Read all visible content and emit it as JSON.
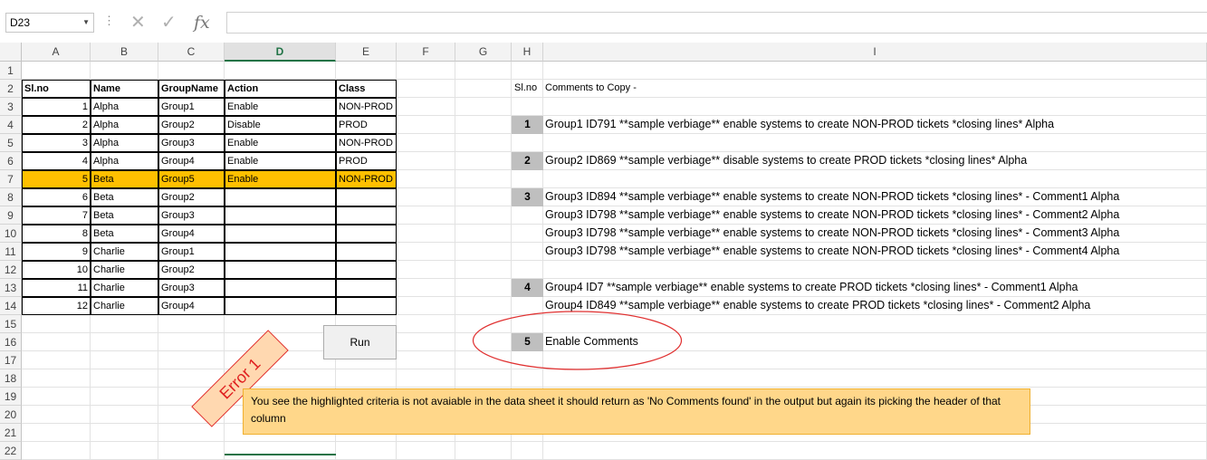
{
  "formula_bar": {
    "name_box": "D23",
    "dots": "⋮",
    "cancel_icon": "✕",
    "enter_icon": "✓",
    "fx_label": "fx",
    "formula": ""
  },
  "columns": [
    "A",
    "B",
    "C",
    "D",
    "E",
    "F",
    "G",
    "H",
    "I"
  ],
  "rows": [
    "1",
    "2",
    "3",
    "4",
    "5",
    "6",
    "7",
    "8",
    "9",
    "10",
    "11",
    "12",
    "13",
    "14",
    "15",
    "16",
    "17",
    "18",
    "19",
    "20",
    "21",
    "22"
  ],
  "table": {
    "headers": [
      "Sl.no",
      "Name",
      "GroupName",
      "Action",
      "Class"
    ],
    "rows": [
      [
        "1",
        "Alpha",
        "Group1",
        "Enable",
        "NON-PROD"
      ],
      [
        "2",
        "Alpha",
        "Group2",
        "Disable",
        "PROD"
      ],
      [
        "3",
        "Alpha",
        "Group3",
        "Enable",
        "NON-PROD"
      ],
      [
        "4",
        "Alpha",
        "Group4",
        "Enable",
        "PROD"
      ],
      [
        "5",
        "Beta",
        "Group5",
        "Enable",
        "NON-PROD"
      ],
      [
        "6",
        "Beta",
        "Group2",
        "",
        ""
      ],
      [
        "7",
        "Beta",
        "Group3",
        "",
        ""
      ],
      [
        "8",
        "Beta",
        "Group4",
        "",
        ""
      ],
      [
        "9",
        "Charlie",
        "Group1",
        "",
        ""
      ],
      [
        "10",
        "Charlie",
        "Group2",
        "",
        ""
      ],
      [
        "11",
        "Charlie",
        "Group3",
        "",
        ""
      ],
      [
        "12",
        "Charlie",
        "Group4",
        "",
        ""
      ]
    ],
    "highlight_color": "#ffc000"
  },
  "output": {
    "header_slno": "Sl.no",
    "header_comments": "Comments to Copy -",
    "items": [
      {
        "row": 4,
        "no": "1",
        "text": "Group1 ID791 **sample verbiage** enable systems to create NON-PROD tickets *closing lines* Alpha"
      },
      {
        "row": 6,
        "no": "2",
        "text": "Group2 ID869 **sample verbiage** disable systems to create PROD tickets *closing lines* Alpha"
      },
      {
        "row": 8,
        "no": "3",
        "text": "Group3 ID894 **sample verbiage** enable systems to create NON-PROD tickets *closing lines*  - Comment1 Alpha"
      },
      {
        "row": 9,
        "no": "",
        "text": "Group3 ID798 **sample verbiage** enable systems to create NON-PROD tickets *closing lines*  - Comment2 Alpha"
      },
      {
        "row": 10,
        "no": "",
        "text": "Group3 ID798 **sample verbiage** enable systems to create NON-PROD tickets *closing lines*  - Comment3 Alpha"
      },
      {
        "row": 11,
        "no": "",
        "text": "Group3 ID798 **sample verbiage** enable systems to create NON-PROD tickets *closing lines*  - Comment4 Alpha"
      },
      {
        "row": 13,
        "no": "4",
        "text": "Group4 ID7 **sample verbiage** enable systems to create PROD tickets *closing lines*  - Comment1 Alpha"
      },
      {
        "row": 14,
        "no": "",
        "text": "Group4 ID849 **sample verbiage** enable systems to create PROD tickets *closing lines*  - Comment2 Alpha"
      },
      {
        "row": 16,
        "no": "5",
        "text": "Enable Comments"
      }
    ]
  },
  "run_button": "Run",
  "error_tag": "Error 1",
  "note": "You see the highlighted criteria is not avaiable in the data sheet it should return as 'No Comments found' in the output but again its picking the header of that column",
  "colors": {
    "accent": "#217346",
    "error": "#e02020",
    "note_bg": "#ffd78a"
  }
}
